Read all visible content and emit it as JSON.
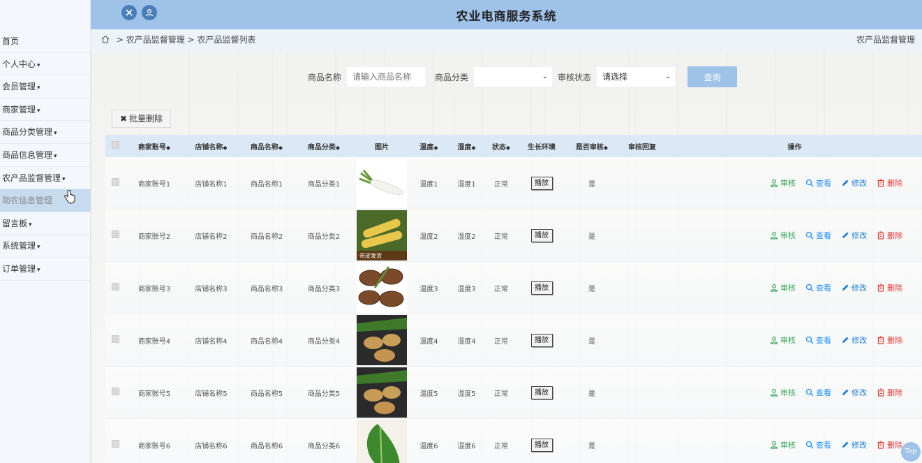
{
  "app": {
    "title": "农业电商服务系统"
  },
  "sidebar": {
    "items": [
      {
        "label": "首页",
        "caret": ""
      },
      {
        "label": "个人中心",
        "caret": "▾"
      },
      {
        "label": "会员管理",
        "caret": "▾"
      },
      {
        "label": "商家管理",
        "caret": "▾"
      },
      {
        "label": "商品分类管理",
        "caret": "▾"
      },
      {
        "label": "商品信息管理",
        "caret": "▾"
      },
      {
        "label": "农产品监督管理",
        "caret": "▾"
      },
      {
        "label": "助农信息管理",
        "caret": ""
      },
      {
        "label": "留言板",
        "caret": "▾"
      },
      {
        "label": "系统管理",
        "caret": "▾"
      },
      {
        "label": "订单管理",
        "caret": "▾"
      }
    ]
  },
  "breadcrumb": {
    "sep1": ">",
    "level1": "农产品监督管理",
    "sep2": ">",
    "level2": "农产品监督列表",
    "right_title": "农产品监督管理"
  },
  "search": {
    "name_label": "商品名称",
    "name_placeholder": "请输入商品名称",
    "category_label": "商品分类",
    "category_value": "",
    "status_label": "审核状态",
    "status_value": "请选择",
    "query_label": "查询"
  },
  "batch_delete_label": "批量删除",
  "table": {
    "headers": {
      "account": "商家账号",
      "shop": "店铺名称",
      "name": "商品名称",
      "category": "商品分类",
      "image": "图片",
      "temp": "温度",
      "humidity": "湿度",
      "status": "状态",
      "env": "生长环境",
      "audited": "是否审核",
      "reply": "审核回复",
      "ops": "操作"
    },
    "rows": [
      {
        "account": "商家账号1",
        "shop": "店铺名称1",
        "name": "商品名称1",
        "category": "商品分类1",
        "image": "radish",
        "temp": "温度1",
        "humidity": "湿度1",
        "status": "正常",
        "env": "播放",
        "audited": "是",
        "reply": ""
      },
      {
        "account": "商家账号2",
        "shop": "店铺名称2",
        "name": "商品名称2",
        "category": "商品分类2",
        "image": "corn",
        "image_caption": "带皮发货",
        "temp": "温度2",
        "humidity": "湿度2",
        "status": "正常",
        "env": "播放",
        "audited": "是",
        "reply": ""
      },
      {
        "account": "商家账号3",
        "shop": "店铺名称3",
        "name": "商品名称3",
        "category": "商品分类3",
        "image": "mushroom",
        "temp": "温度3",
        "humidity": "湿度3",
        "status": "正常",
        "env": "播放",
        "audited": "是",
        "reply": ""
      },
      {
        "account": "商家账号4",
        "shop": "店铺名称4",
        "name": "商品名称4",
        "category": "商品分类4",
        "image": "potato",
        "temp": "温度4",
        "humidity": "湿度4",
        "status": "正常",
        "env": "播放",
        "audited": "是",
        "reply": ""
      },
      {
        "account": "商家账号5",
        "shop": "店铺名称5",
        "name": "商品名称5",
        "category": "商品分类5",
        "image": "potato",
        "temp": "温度5",
        "humidity": "湿度5",
        "status": "正常",
        "env": "播放",
        "audited": "是",
        "reply": ""
      },
      {
        "account": "商家账号6",
        "shop": "店铺名称6",
        "name": "商品名称6",
        "category": "商品分类6",
        "image": "greens",
        "temp": "温度6",
        "humidity": "湿度6",
        "status": "正常",
        "env": "播放",
        "audited": "是",
        "reply": ""
      }
    ],
    "ops": {
      "audit": "审核",
      "view": "查看",
      "edit": "修改",
      "delete": "删除"
    }
  },
  "top_button_label": "Top",
  "colors": {
    "topbar": "#9ec2e8",
    "audit": "#3aa757",
    "view": "#1e90ff",
    "edit": "#1e7fd6",
    "delete": "#e53935"
  },
  "icons": {
    "topbar": [
      "fullscreen-icon",
      "user-icon"
    ],
    "breadcrumb": "home-icon",
    "ops": [
      "user-check-icon",
      "search-icon",
      "pencil-icon",
      "trash-icon"
    ]
  }
}
